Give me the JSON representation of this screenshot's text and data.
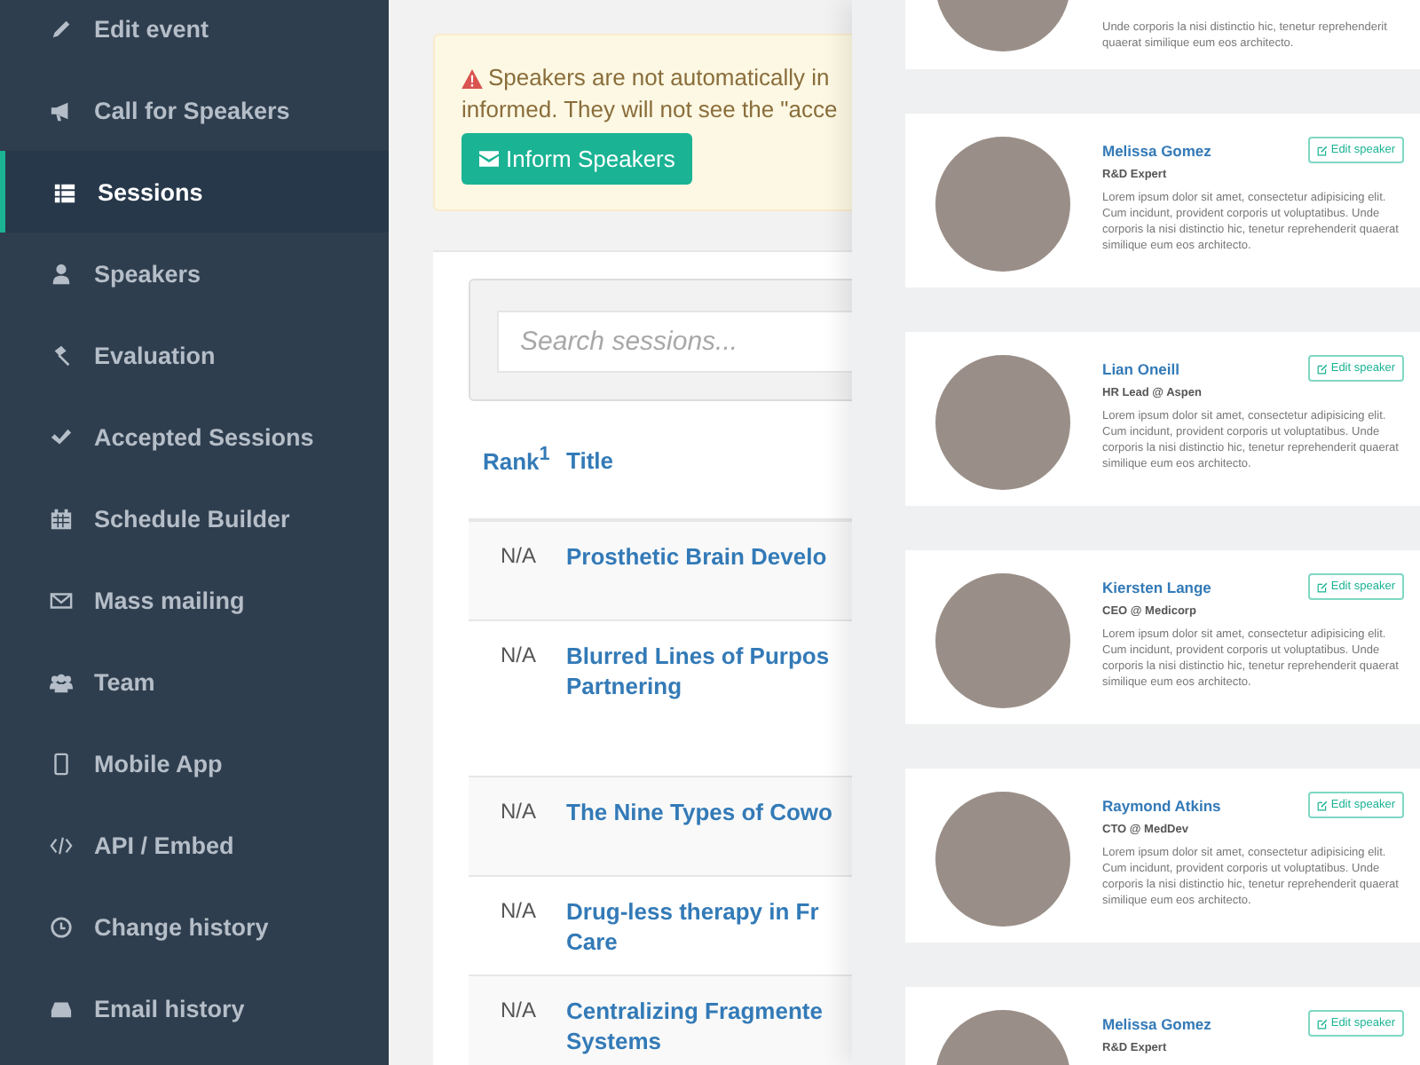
{
  "sidebar": {
    "items": [
      {
        "label": "Edit event",
        "selected": false
      },
      {
        "label": "Call for Speakers",
        "selected": false
      },
      {
        "label": "Sessions",
        "selected": true
      },
      {
        "label": "Speakers",
        "selected": false
      },
      {
        "label": "Evaluation",
        "selected": false
      },
      {
        "label": "Accepted Sessions",
        "selected": false
      },
      {
        "label": "Schedule Builder",
        "selected": false
      },
      {
        "label": "Mass mailing",
        "selected": false
      },
      {
        "label": "Team",
        "selected": false
      },
      {
        "label": "Mobile App",
        "selected": false
      },
      {
        "label": "API / Embed",
        "selected": false
      },
      {
        "label": "Change history",
        "selected": false
      },
      {
        "label": "Email history",
        "selected": false
      }
    ]
  },
  "alert": {
    "lines": [
      "Speakers are not automatically in",
      "informed. They will not see the \"acce"
    ],
    "button": "Inform Speakers"
  },
  "search": {
    "placeholder": "Search sessions..."
  },
  "table": {
    "columns": [
      "Rank$^{1}$",
      "Title"
    ],
    "rows": [
      {
        "rank": "N/A",
        "title": [
          "Prosthetic Brain Develo"
        ]
      },
      {
        "rank": "N/A",
        "title": [
          "Blurred Lines of Purpos",
          "Partnering"
        ]
      },
      {
        "rank": "N/A",
        "title": [
          "The Nine Types of Cowo"
        ]
      },
      {
        "rank": "N/A",
        "title": [
          "Drug-less therapy in Fr",
          "Care"
        ]
      },
      {
        "rank": "N/A",
        "title": [
          "Centralizing Fragmente",
          "Systems"
        ]
      }
    ]
  },
  "speakers": [
    {
      "kind": "partial-top",
      "description": "Unde corporis la nisi distinctio hic, tenetur reprehenderit quaerat similique eum eos architecto."
    },
    {
      "kind": "full",
      "name": "Melissa Gomez",
      "role": "R&D Expert",
      "button": "Edit speaker",
      "description": "Lorem ipsum dolor sit amet, consectetur adipisicing elit. Cum incidunt, provident corporis ut voluptatibus. Unde corporis la nisi distinctio hic, tenetur reprehenderit quaerat similique eum eos architecto."
    },
    {
      "kind": "full",
      "name": "Lian Oneill",
      "role": "HR Lead @ Aspen",
      "button": "Edit speaker",
      "description": "Lorem ipsum dolor sit amet, consectetur adipisicing elit. Cum incidunt, provident corporis ut voluptatibus. Unde corporis la nisi distinctio hic, tenetur reprehenderit quaerat similique eum eos architecto."
    },
    {
      "kind": "full",
      "name": "Kiersten Lange",
      "role": "CEO @ Medicorp",
      "button": "Edit speaker",
      "description": "Lorem ipsum dolor sit amet, consectetur adipisicing elit. Cum incidunt, provident corporis ut voluptatibus. Unde corporis la nisi distinctio hic, tenetur reprehenderit quaerat similique eum eos architecto."
    },
    {
      "kind": "full",
      "name": "Raymond Atkins",
      "role": "CTO @ MedDev",
      "button": "Edit speaker",
      "description": "Lorem ipsum dolor sit amet, consectetur adipisicing elit. Cum incidunt, provident corporis ut voluptatibus. Unde corporis la nisi distinctio hic, tenetur reprehenderit quaerat similique eum eos architecto."
    },
    {
      "kind": "partial-bottom",
      "name": "Melissa Gomez",
      "role": "R&D Expert",
      "button": "Edit speaker"
    }
  ]
}
